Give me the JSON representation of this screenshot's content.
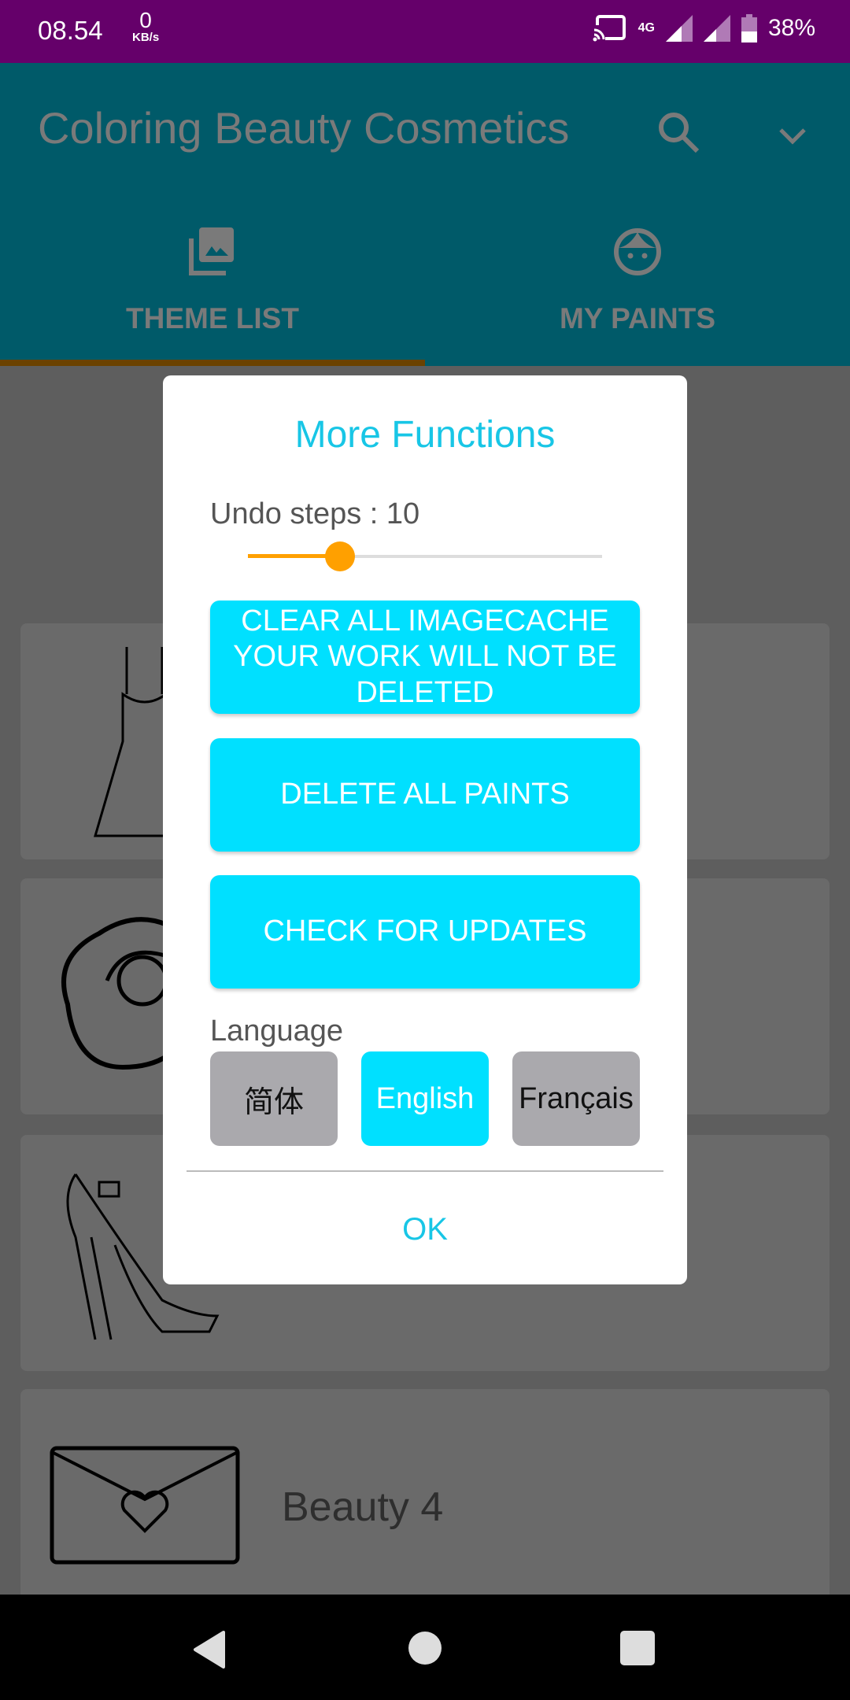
{
  "status_bar": {
    "time": "08.54",
    "speed_value": "0",
    "speed_unit": "KB/s",
    "network": "4G",
    "battery": "38%"
  },
  "app_bar": {
    "title": "Coloring Beauty Cosmetics",
    "search_icon": "search-icon",
    "menu_icon": "chevron-down-icon"
  },
  "tabs": [
    {
      "label": "THEME LIST",
      "icon": "photo-library-icon",
      "active": true
    },
    {
      "label": "MY PAINTS",
      "icon": "face-icon",
      "active": false
    }
  ],
  "colors": {
    "primary": "#00bcd4",
    "accent": "#ff9800",
    "button": "#00e0ff",
    "title": "#18c6e6",
    "status_bar": "#65006a"
  },
  "list": [
    {
      "name": "",
      "thumb": "dress"
    },
    {
      "name": "",
      "thumb": "rose"
    },
    {
      "name": "",
      "thumb": "high-heel-shoe"
    },
    {
      "name": "Beauty 4",
      "thumb": "envelope-heart"
    }
  ],
  "dialog": {
    "title": "More Functions",
    "undo_label": "Undo steps : 10",
    "undo_value": 10,
    "undo_slider_fraction": 0.26,
    "buttons": {
      "clear_cache": "CLEAR ALL IMAGECACHE YOUR WORK WILL NOT BE DELETED",
      "delete_paints": "DELETE ALL PAINTS",
      "check_updates": "CHECK FOR UPDATES"
    },
    "language_label": "Language",
    "languages": [
      {
        "label": "简体",
        "selected": false
      },
      {
        "label": "English",
        "selected": true
      },
      {
        "label": "Français",
        "selected": false
      }
    ],
    "ok": "OK"
  }
}
